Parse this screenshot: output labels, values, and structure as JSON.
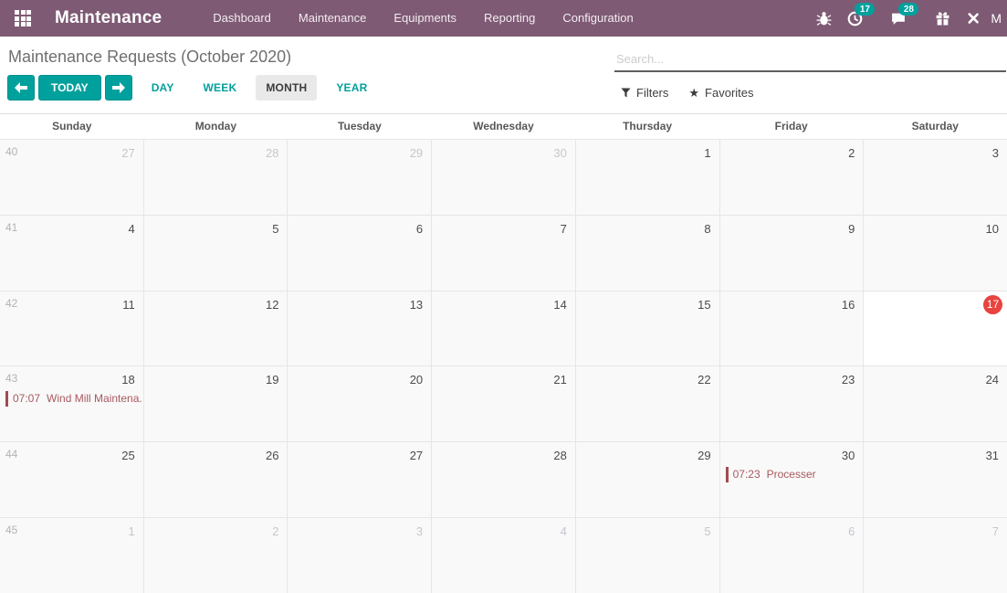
{
  "colors": {
    "navbar_bg": "#7e5a74",
    "accent_teal": "#00a09d",
    "today_badge_red": "#e8433e",
    "event_red": "#a85a60"
  },
  "navbar": {
    "brand": "Maintenance",
    "menu_items": [
      "Dashboard",
      "Maintenance",
      "Equipments",
      "Reporting",
      "Configuration"
    ],
    "systray": [
      {
        "name": "bug-icon",
        "badge": ""
      },
      {
        "name": "activity-clock-icon",
        "badge": "17"
      },
      {
        "name": "messages-icon",
        "badge": "28"
      },
      {
        "name": "gift-icon",
        "badge": ""
      },
      {
        "name": "debug-tools-icon",
        "badge": ""
      }
    ],
    "user_initial": "M"
  },
  "header": {
    "title": "Maintenance Requests (October 2020)",
    "search_placeholder": "Search...",
    "buttons": {
      "today": "TODAY",
      "day": "DAY",
      "week": "WEEK",
      "month": "MONTH",
      "year": "YEAR"
    },
    "active_view": "MONTH",
    "filters_label": "Filters",
    "favorites_label": "Favorites"
  },
  "calendar": {
    "day_headers": [
      "Sunday",
      "Monday",
      "Tuesday",
      "Wednesday",
      "Thursday",
      "Friday",
      "Saturday"
    ],
    "weeks": [
      {
        "week_num": "40",
        "days": [
          {
            "num": "27",
            "other": true
          },
          {
            "num": "28",
            "other": true
          },
          {
            "num": "29",
            "other": true
          },
          {
            "num": "30",
            "other": true
          },
          {
            "num": "1"
          },
          {
            "num": "2"
          },
          {
            "num": "3"
          }
        ]
      },
      {
        "week_num": "41",
        "days": [
          {
            "num": "4"
          },
          {
            "num": "5"
          },
          {
            "num": "6"
          },
          {
            "num": "7"
          },
          {
            "num": "8"
          },
          {
            "num": "9"
          },
          {
            "num": "10"
          }
        ]
      },
      {
        "week_num": "42",
        "days": [
          {
            "num": "11"
          },
          {
            "num": "12"
          },
          {
            "num": "13"
          },
          {
            "num": "14"
          },
          {
            "num": "15"
          },
          {
            "num": "16"
          },
          {
            "num": "17",
            "today": true
          }
        ]
      },
      {
        "week_num": "43",
        "days": [
          {
            "num": "18",
            "events": [
              {
                "time": "07:07",
                "title": "Wind Mill Maintena..."
              }
            ]
          },
          {
            "num": "19"
          },
          {
            "num": "20"
          },
          {
            "num": "21"
          },
          {
            "num": "22"
          },
          {
            "num": "23"
          },
          {
            "num": "24"
          }
        ]
      },
      {
        "week_num": "44",
        "days": [
          {
            "num": "25"
          },
          {
            "num": "26"
          },
          {
            "num": "27"
          },
          {
            "num": "28"
          },
          {
            "num": "29"
          },
          {
            "num": "30",
            "events": [
              {
                "time": "07:23",
                "title": "Processer"
              }
            ]
          },
          {
            "num": "31"
          }
        ]
      },
      {
        "week_num": "45",
        "days": [
          {
            "num": "1",
            "other": true
          },
          {
            "num": "2",
            "other": true
          },
          {
            "num": "3",
            "other": true
          },
          {
            "num": "4",
            "other": true
          },
          {
            "num": "5",
            "other": true
          },
          {
            "num": "6",
            "other": true
          },
          {
            "num": "7",
            "other": true
          }
        ]
      }
    ]
  }
}
